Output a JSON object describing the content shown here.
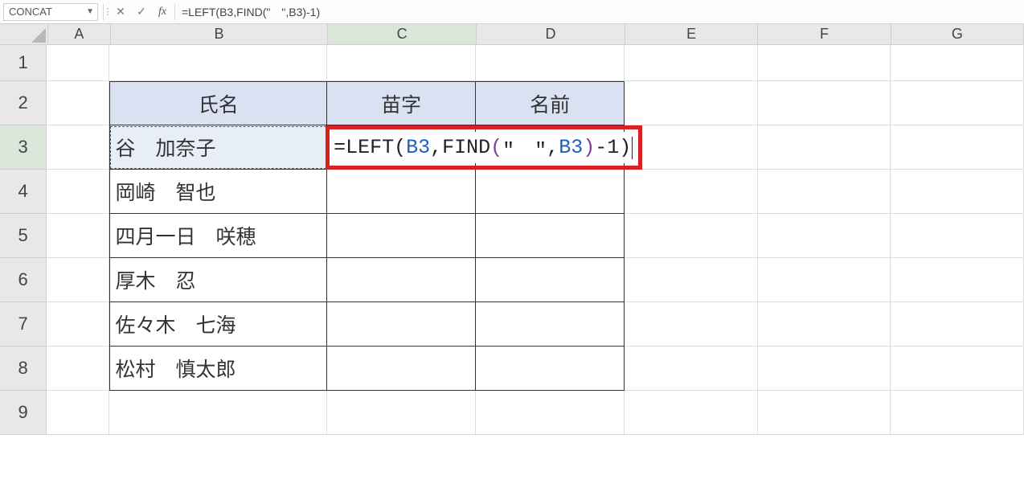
{
  "name_box": "CONCAT",
  "formula_bar": "=LEFT(B3,FIND(\"　\",B3)-1)",
  "fb_buttons": {
    "cancel": "✕",
    "enter": "✓",
    "fx": "fx"
  },
  "columns": [
    "A",
    "B",
    "C",
    "D",
    "E",
    "F",
    "G"
  ],
  "row_numbers": [
    "1",
    "2",
    "3",
    "4",
    "5",
    "6",
    "7",
    "8",
    "9"
  ],
  "header_row": {
    "B": "氏名",
    "C": "苗字",
    "D": "名前"
  },
  "data_rows": [
    {
      "B": "谷　加奈子"
    },
    {
      "B": "岡崎　智也"
    },
    {
      "B": "四月一日　咲穂"
    },
    {
      "B": "厚木　忍"
    },
    {
      "B": "佐々木　七海"
    },
    {
      "B": "松村　慎太郎"
    }
  ],
  "editing_formula": {
    "parts": [
      {
        "t": "=LEFT",
        "c": "tok-black"
      },
      {
        "t": "(",
        "c": "tok-paren1"
      },
      {
        "t": "B3",
        "c": "tok-ref"
      },
      {
        "t": ",FIND",
        "c": "tok-black"
      },
      {
        "t": "(",
        "c": "tok-paren2"
      },
      {
        "t": "\"　\"",
        "c": "tok-black"
      },
      {
        "t": ",",
        "c": "tok-black"
      },
      {
        "t": "B3",
        "c": "tok-ref"
      },
      {
        "t": ")",
        "c": "tok-paren2"
      },
      {
        "t": "-1",
        "c": "tok-black"
      },
      {
        "t": ")",
        "c": "tok-paren1"
      }
    ]
  },
  "active": {
    "col": "C",
    "row": "3"
  },
  "chart_data": {
    "type": "table",
    "title": "",
    "columns": [
      "氏名",
      "苗字",
      "名前"
    ],
    "rows": [
      [
        "谷　加奈子",
        "",
        ""
      ],
      [
        "岡崎　智也",
        "",
        ""
      ],
      [
        "四月一日　咲穂",
        "",
        ""
      ],
      [
        "厚木　忍",
        "",
        ""
      ],
      [
        "佐々木　七海",
        "",
        ""
      ],
      [
        "松村　慎太郎",
        "",
        ""
      ]
    ]
  }
}
